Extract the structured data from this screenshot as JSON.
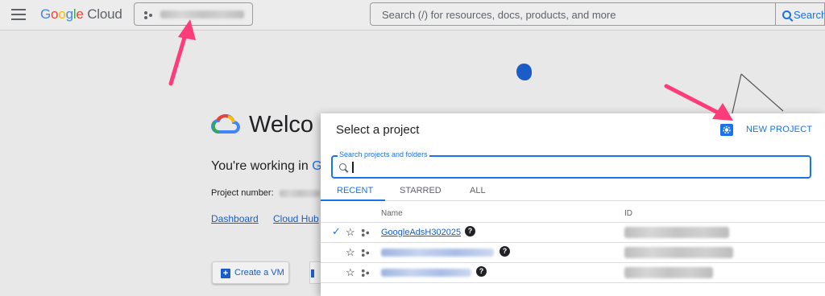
{
  "header": {
    "logo": {
      "google": "Google",
      "cloud": "Cloud"
    },
    "search": {
      "placeholder": "Search (/) for resources, docs, products, and more",
      "button_label": "Search"
    }
  },
  "background_page": {
    "welcome": "Welco",
    "working_in_prefix": "You're working in",
    "working_in_project": "Goog",
    "project_number_label": "Project number:",
    "links": [
      "Dashboard",
      "Cloud Hub"
    ],
    "create_vm_label": "Create a VM"
  },
  "dialog": {
    "title": "Select a project",
    "new_project_label": "NEW PROJECT",
    "search_label": "Search projects and folders",
    "tabs": [
      "RECENT",
      "STARRED",
      "ALL"
    ],
    "columns": {
      "name": "Name",
      "id": "ID"
    },
    "rows": [
      {
        "name": "GoogleAdsH302025",
        "selected": true
      }
    ]
  },
  "colors": {
    "accent": "#1a73e8",
    "annotation_arrow": "#ff3c7a"
  }
}
